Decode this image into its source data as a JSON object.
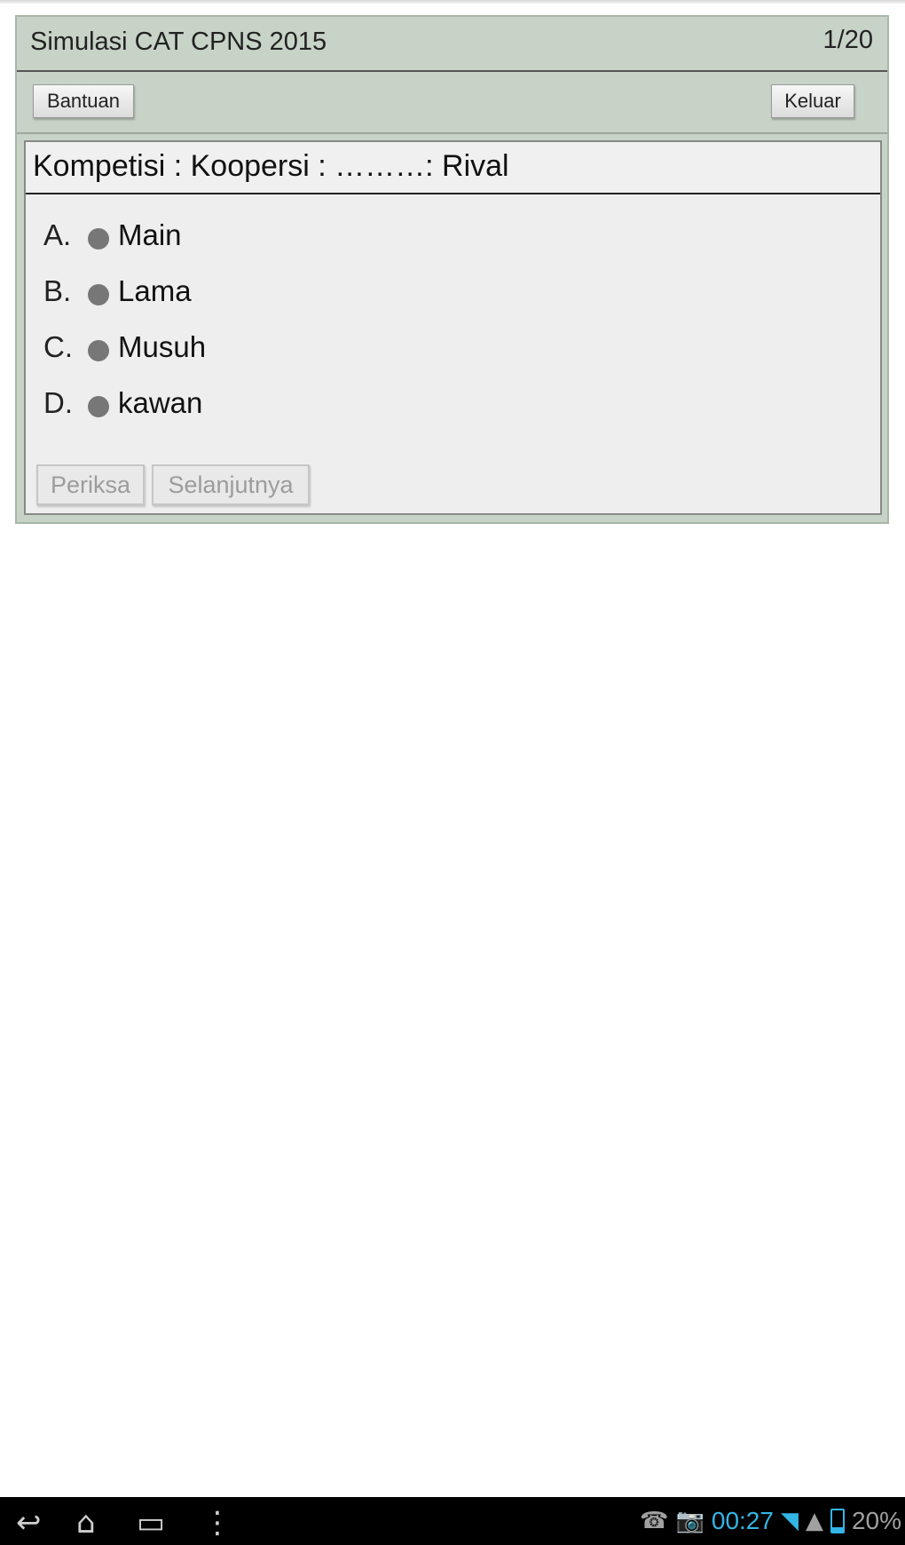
{
  "app": {
    "title": "Simulasi CAT CPNS 2015",
    "counter": "1/20"
  },
  "toolbar": {
    "help_label": "Bantuan",
    "exit_label": "Keluar"
  },
  "question": {
    "text": "Kompetisi : Koopersi : ………: Rival",
    "options": [
      {
        "letter": "A.",
        "text": "Main"
      },
      {
        "letter": "B.",
        "text": "Lama"
      },
      {
        "letter": "C.",
        "text": "Musuh"
      },
      {
        "letter": "D.",
        "text": "kawan"
      }
    ]
  },
  "actions": {
    "check_label": "Periksa",
    "next_label": "Selanjutnya"
  },
  "system_bar": {
    "time": "00:27",
    "battery": "20%",
    "icons": [
      "back-icon",
      "home-icon",
      "recent-apps-icon",
      "overflow-menu-icon",
      "missed-call-icon",
      "camera-icon",
      "wifi-icon",
      "signal-icon",
      "battery-icon"
    ]
  },
  "colors": {
    "frame": "#c8d3c8",
    "card": "#eeeeee",
    "clock": "#33b5e5",
    "radio": "#777777"
  }
}
